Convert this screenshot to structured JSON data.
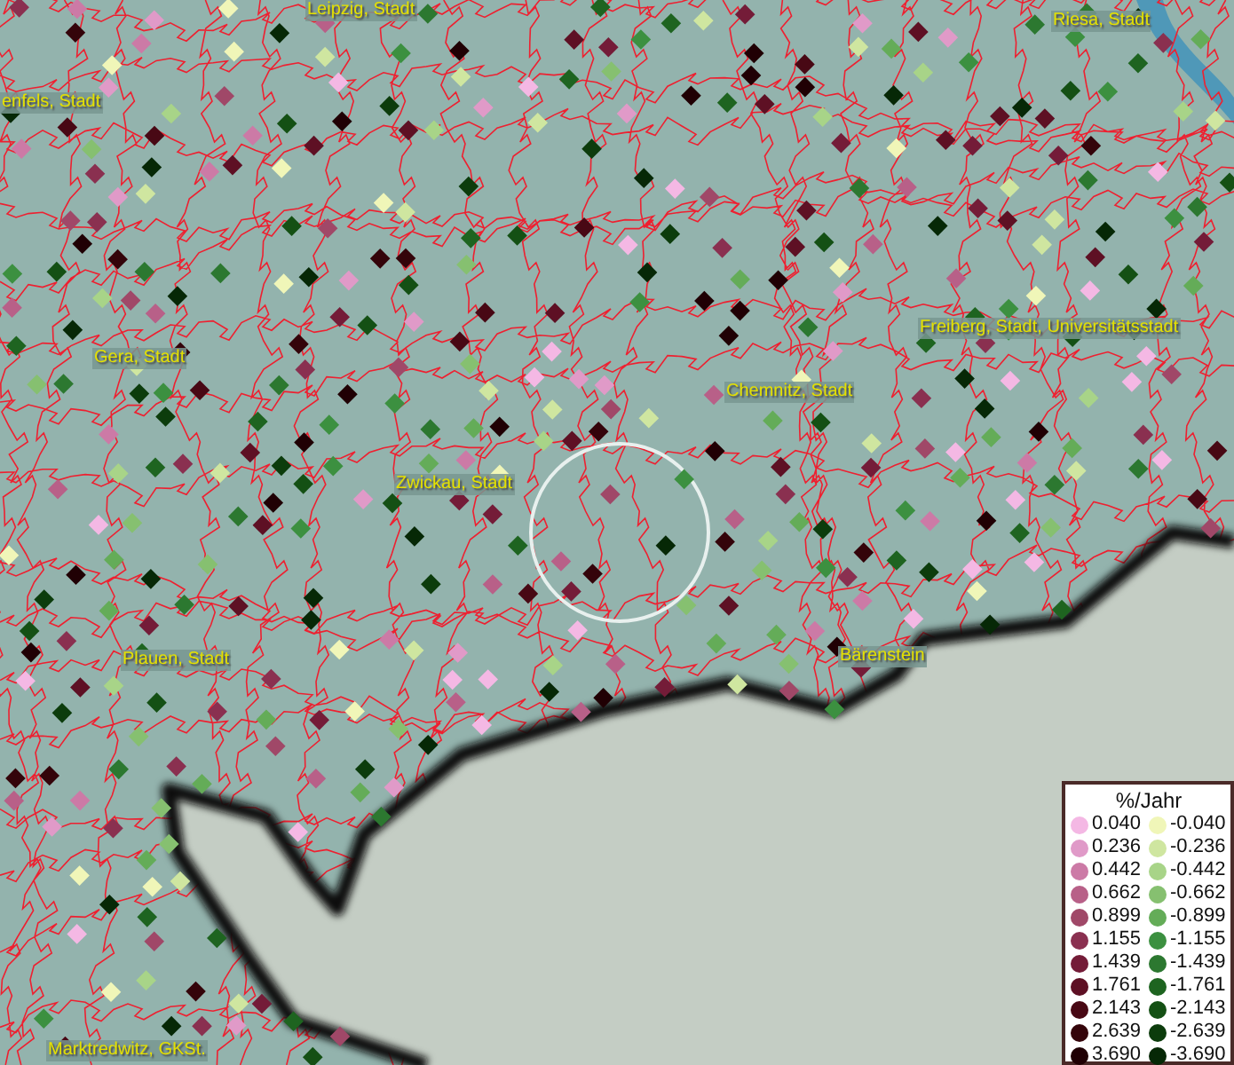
{
  "map": {
    "city_labels": [
      {
        "text": "Leipzig, Stadt"
      },
      {
        "text": "Riesa, Stadt"
      },
      {
        "text": "enfels, Stadt"
      },
      {
        "text": "Gera, Stadt"
      },
      {
        "text": "Freiberg, Stadt, Universitätsstadt"
      },
      {
        "text": "Chemnitz, Stadt"
      },
      {
        "text": "Zwickau, Stadt"
      },
      {
        "text": "Plauen, Stadt"
      },
      {
        "text": "Bärenstein"
      },
      {
        "text": "Marktredwitz, GKSt."
      }
    ]
  },
  "legend": {
    "title": "%/Jahr",
    "rows": [
      {
        "left": {
          "label": "0.040",
          "color": "#f4b8e4"
        },
        "right": {
          "label": "-0.040",
          "color": "#f0f6b8"
        }
      },
      {
        "left": {
          "label": "0.236",
          "color": "#e09ac8"
        },
        "right": {
          "label": "-0.236",
          "color": "#cfe6a0"
        }
      },
      {
        "left": {
          "label": "0.442",
          "color": "#cc7aa6"
        },
        "right": {
          "label": "-0.442",
          "color": "#a8d488"
        }
      },
      {
        "left": {
          "label": "0.662",
          "color": "#b86088"
        },
        "right": {
          "label": "-0.662",
          "color": "#86c070"
        }
      },
      {
        "left": {
          "label": "0.899",
          "color": "#a04868"
        },
        "right": {
          "label": "-0.899",
          "color": "#64ac58"
        }
      },
      {
        "left": {
          "label": "1.155",
          "color": "#8a3050"
        },
        "right": {
          "label": "-1.155",
          "color": "#3c9040"
        }
      },
      {
        "left": {
          "label": "1.439",
          "color": "#741c38"
        },
        "right": {
          "label": "-1.439",
          "color": "#2c7830"
        }
      },
      {
        "left": {
          "label": "1.761",
          "color": "#5e1024"
        },
        "right": {
          "label": "-1.761",
          "color": "#1e6420"
        }
      },
      {
        "left": {
          "label": "2.143",
          "color": "#480814"
        },
        "right": {
          "label": "-2.143",
          "color": "#145014"
        }
      },
      {
        "left": {
          "label": "2.639",
          "color": "#34040a"
        },
        "right": {
          "label": "-2.639",
          "color": "#0c3c0c"
        }
      },
      {
        "left": {
          "label": "3.690",
          "color": "#200004"
        },
        "right": {
          "label": "-3.690",
          "color": "#062806"
        }
      }
    ]
  }
}
